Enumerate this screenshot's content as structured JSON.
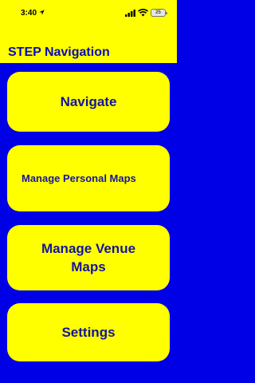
{
  "status_bar": {
    "time": "3:40",
    "battery_level": "25"
  },
  "header": {
    "title": "STEP Navigation"
  },
  "menu": {
    "navigate": "Navigate",
    "manage_personal_maps": "Manage Personal Maps",
    "manage_venue_maps": "Manage Venue Maps",
    "settings": "Settings"
  },
  "colors": {
    "background": "#0000e6",
    "button": "#ffff00",
    "text": "#14149e"
  },
  "icons": {
    "location": "location-arrow-icon",
    "signal": "cellular-signal-icon",
    "wifi": "wifi-icon",
    "battery": "battery-icon"
  }
}
